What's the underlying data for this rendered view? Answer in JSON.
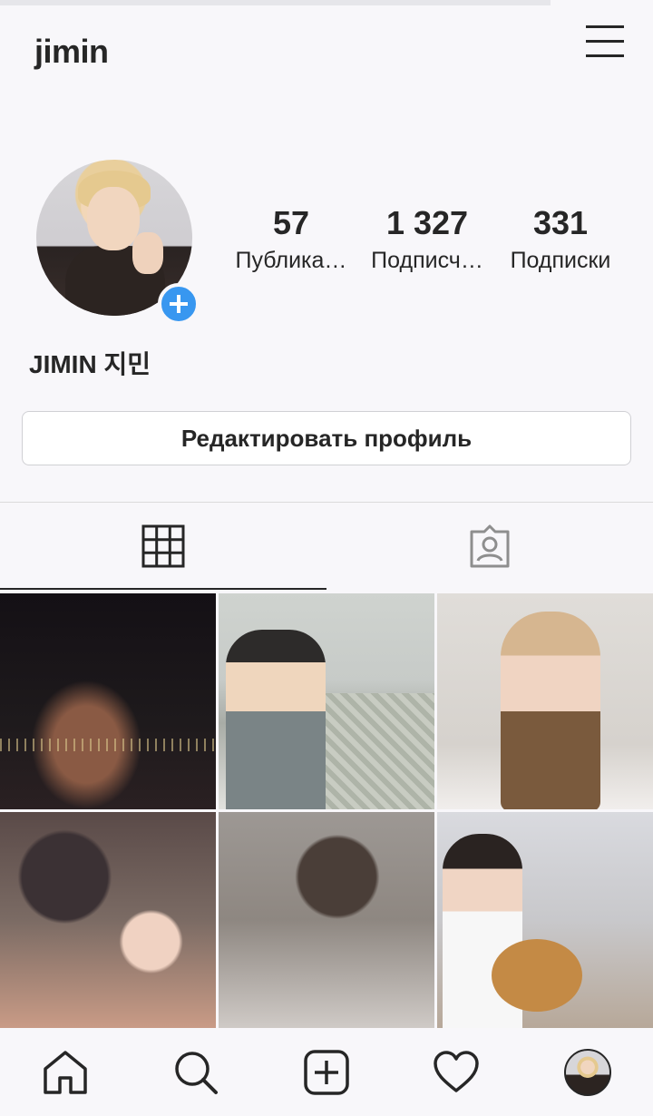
{
  "header": {
    "username": "jimin"
  },
  "profile": {
    "full_name": "JIMIN 지민",
    "stats": {
      "posts": {
        "value": "57",
        "label": "Публика…"
      },
      "followers": {
        "value": "1 327",
        "label": "Подписч…"
      },
      "following": {
        "value": "331",
        "label": "Подписки"
      }
    },
    "edit_button": "Редактировать профиль"
  },
  "tabs": [
    {
      "icon": "grid-icon",
      "active": true
    },
    {
      "icon": "tagged-person-icon",
      "active": false
    }
  ],
  "posts_grid": [
    "post-1",
    "post-2",
    "post-3",
    "post-4",
    "post-5",
    "post-6"
  ],
  "bottom_nav": [
    {
      "icon": "home-icon"
    },
    {
      "icon": "search-icon"
    },
    {
      "icon": "add-post-icon"
    },
    {
      "icon": "heart-icon"
    },
    {
      "icon": "profile-avatar"
    }
  ],
  "colors": {
    "accent": "#3897f0",
    "text": "#262626",
    "background": "#f8f7fa"
  }
}
